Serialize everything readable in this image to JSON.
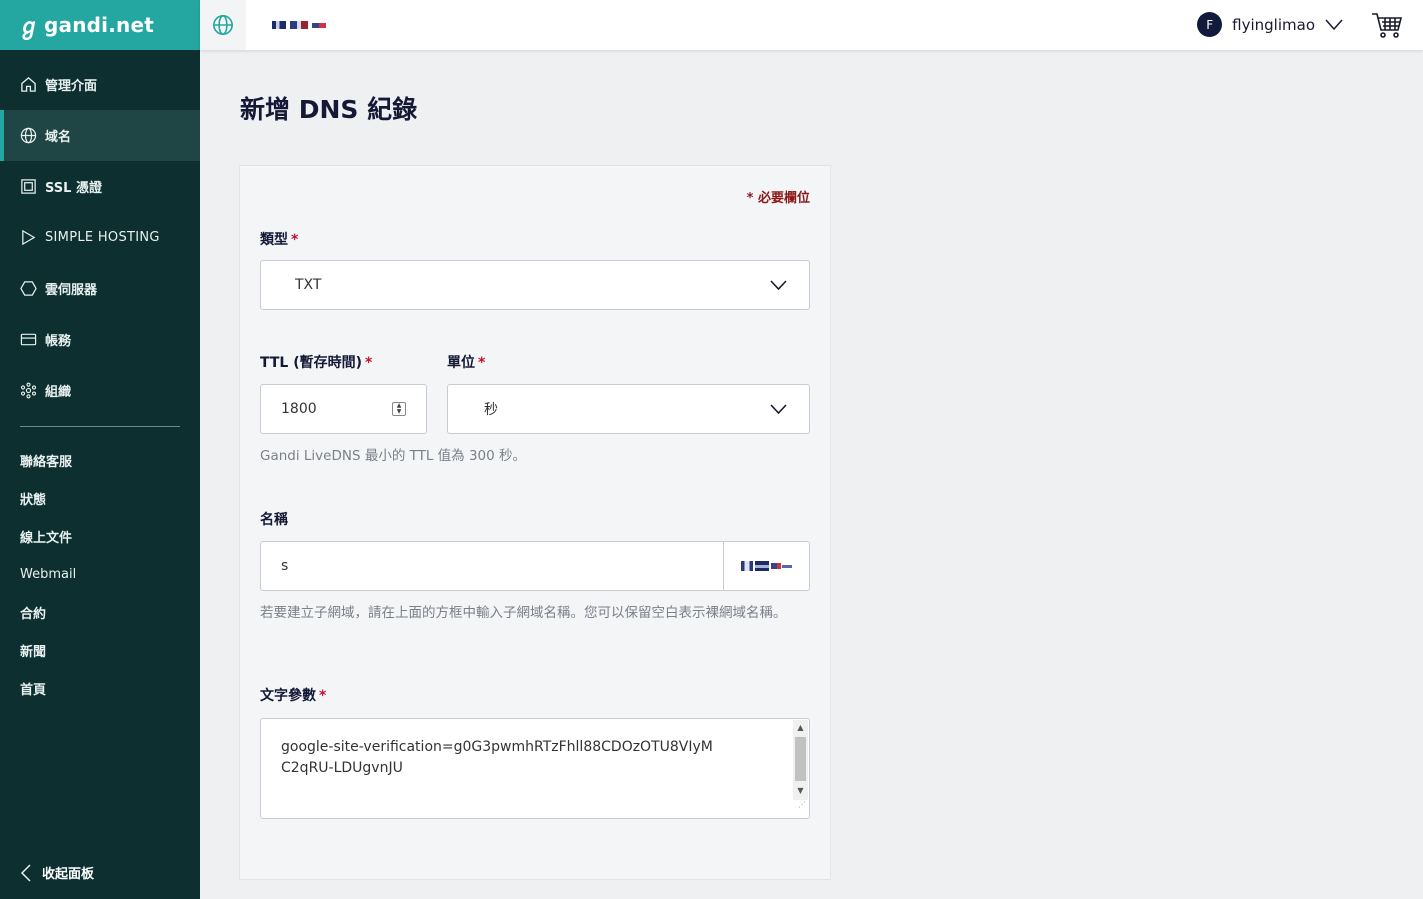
{
  "brand": {
    "name": "gandi.net",
    "accent": "#23a7a0",
    "sidebar_bg": "#0d2f2f"
  },
  "sidebar": {
    "items": [
      {
        "label": "管理介面",
        "icon": "home-icon"
      },
      {
        "label": "域名",
        "icon": "globe-icon",
        "active": true
      },
      {
        "label": "SSL 憑證",
        "icon": "certificate-icon"
      },
      {
        "label": "SIMPLE HOSTING",
        "icon": "play-icon"
      },
      {
        "label": "雲伺服器",
        "icon": "hexagon-icon"
      },
      {
        "label": "帳務",
        "icon": "credit-card-icon"
      },
      {
        "label": "組織",
        "icon": "organization-icon"
      }
    ],
    "links": [
      "聯絡客服",
      "狀態",
      "線上文件",
      "Webmail",
      "合約",
      "新聞",
      "首頁"
    ],
    "collapse_label": "收起面板"
  },
  "header": {
    "user_initial": "F",
    "username": "flyinglimao"
  },
  "page": {
    "title": "新增 DNS 紀錄"
  },
  "form": {
    "required_note": "* 必要欄位",
    "type": {
      "label": "類型",
      "value": "TXT"
    },
    "ttl": {
      "label": "TTL (暫存時間)",
      "value": "1800"
    },
    "unit": {
      "label": "單位",
      "value": "秒"
    },
    "ttl_help": "Gandi LiveDNS 最小的 TTL 值為 300 秒。",
    "name": {
      "label": "名稱",
      "value": "s"
    },
    "name_help": "若要建立子網域，請在上面的方框中輸入子網域名稱。您可以保留空白表示裸網域名稱。",
    "text": {
      "label": "文字參數",
      "value": "google-site-verification=g0G3pwmhRTzFhll88CDOzOTU8VIyMC2qRU-LDUgvnJU"
    },
    "required_mark": "*"
  }
}
